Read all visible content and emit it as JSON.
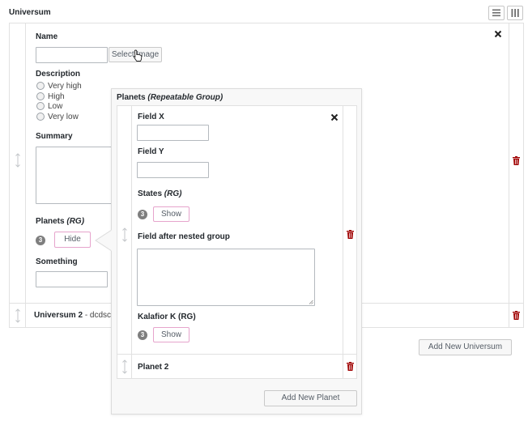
{
  "header": {
    "title": "Universum",
    "list_view_icon": "list-view-icon",
    "column_view_icon": "column-view-icon"
  },
  "universum_1": {
    "name_label": "Name",
    "name_value": "",
    "select_image_label": "Select Image",
    "description_label": "Description",
    "description_options": [
      "Very high",
      "High",
      "Low",
      "Very low"
    ],
    "summary_label": "Summary",
    "planets_label": "Planets",
    "planets_rg": "(RG)",
    "planets_count": "3",
    "planets_toggle_label": "Hide",
    "something_label": "Something"
  },
  "universum_2": {
    "title": "Universum 2",
    "subtitle": "- dcdscds"
  },
  "add_new_universum_label": "Add New Universum",
  "planets_popup": {
    "title": "Planets",
    "title_suffix": "(Repeatable Group)",
    "field_x_label": "Field X",
    "field_y_label": "Field Y",
    "states_label": "States",
    "states_rg": "(RG)",
    "states_count": "3",
    "states_toggle_label": "Show",
    "field_after_label": "Field after nested group",
    "kalafior_label": "Kalafior K (RG)",
    "kalafior_count": "3",
    "kalafior_toggle_label": "Show",
    "planet_2_title": "Planet 2",
    "add_new_planet_label": "Add New Planet"
  },
  "colors": {
    "delete_red": "#a00000",
    "show_button_border": "#e6a4cc",
    "border_gray": "#e1e1e1"
  }
}
